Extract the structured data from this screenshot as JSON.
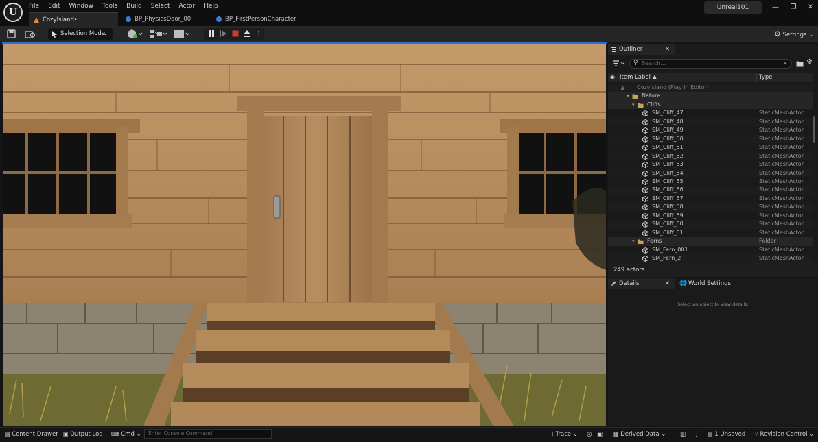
{
  "menu": [
    "File",
    "Edit",
    "Window",
    "Tools",
    "Build",
    "Select",
    "Actor",
    "Help"
  ],
  "tabs": [
    {
      "label": "CozyIsland•",
      "active": true
    },
    {
      "label": "BP_PhysicsDoor_00",
      "active": false
    },
    {
      "label": "BP_FirstPersonCharacter",
      "active": false
    }
  ],
  "project_name": "Unreal101",
  "window_controls": {
    "minimize": "—",
    "restore": "❐",
    "close": "✕"
  },
  "toolbar": {
    "selection_mode": "Selection Mode",
    "settings": "Settings"
  },
  "outliner": {
    "tab_label": "Outliner",
    "search_placeholder": "Search...",
    "col_label": "Item Label ▲",
    "col_type": "Type",
    "rows": [
      {
        "label": "CozyIsland (Play In Editor)",
        "type": "",
        "kind": "world",
        "indent": 0
      },
      {
        "label": "Nature",
        "type": "",
        "kind": "folder",
        "indent": 1
      },
      {
        "label": "Cliffs",
        "type": "",
        "kind": "folder-open",
        "indent": 2
      },
      {
        "label": "SM_Cliff_47",
        "type": "StaticMeshActor",
        "kind": "mesh",
        "indent": 3
      },
      {
        "label": "SM_Cliff_48",
        "type": "StaticMeshActor",
        "kind": "mesh",
        "indent": 3
      },
      {
        "label": "SM_Cliff_49",
        "type": "StaticMeshActor",
        "kind": "mesh",
        "indent": 3
      },
      {
        "label": "SM_Cliff_50",
        "type": "StaticMeshActor",
        "kind": "mesh",
        "indent": 3
      },
      {
        "label": "SM_Cliff_51",
        "type": "StaticMeshActor",
        "kind": "mesh",
        "indent": 3
      },
      {
        "label": "SM_Cliff_52",
        "type": "StaticMeshActor",
        "kind": "mesh",
        "indent": 3
      },
      {
        "label": "SM_Cliff_53",
        "type": "StaticMeshActor",
        "kind": "mesh",
        "indent": 3
      },
      {
        "label": "SM_Cliff_54",
        "type": "StaticMeshActor",
        "kind": "mesh",
        "indent": 3
      },
      {
        "label": "SM_Cliff_55",
        "type": "StaticMeshActor",
        "kind": "mesh",
        "indent": 3
      },
      {
        "label": "SM_Cliff_56",
        "type": "StaticMeshActor",
        "kind": "mesh",
        "indent": 3
      },
      {
        "label": "SM_Cliff_57",
        "type": "StaticMeshActor",
        "kind": "mesh",
        "indent": 3
      },
      {
        "label": "SM_Cliff_58",
        "type": "StaticMeshActor",
        "kind": "mesh",
        "indent": 3
      },
      {
        "label": "SM_Cliff_59",
        "type": "StaticMeshActor",
        "kind": "mesh",
        "indent": 3
      },
      {
        "label": "SM_Cliff_60",
        "type": "StaticMeshActor",
        "kind": "mesh",
        "indent": 3
      },
      {
        "label": "SM_Cliff_61",
        "type": "StaticMeshActor",
        "kind": "mesh",
        "indent": 3
      },
      {
        "label": "Ferns",
        "type": "Folder",
        "kind": "folder",
        "indent": 2
      },
      {
        "label": "SM_Fern_001",
        "type": "StaticMeshActor",
        "kind": "mesh",
        "indent": 3
      },
      {
        "label": "SM_Fern_2",
        "type": "StaticMeshActor",
        "kind": "mesh",
        "indent": 3
      }
    ],
    "actor_count": "249 actors"
  },
  "details": {
    "tab_label": "Details",
    "world_settings_label": "World Settings",
    "empty_message": "Select an object to view details."
  },
  "statusbar": {
    "content_drawer": "Content Drawer",
    "output_log": "Output Log",
    "cmd": "Cmd",
    "console_placeholder": "Enter Console Command",
    "trace": "Trace",
    "derived_data": "Derived Data",
    "unsaved": "1 Unsaved",
    "revision_control": "Revision Control"
  },
  "colors": {
    "accent": "#2a6fd6",
    "play_stop": "#d23a2a",
    "folder": "#c9a25a"
  }
}
